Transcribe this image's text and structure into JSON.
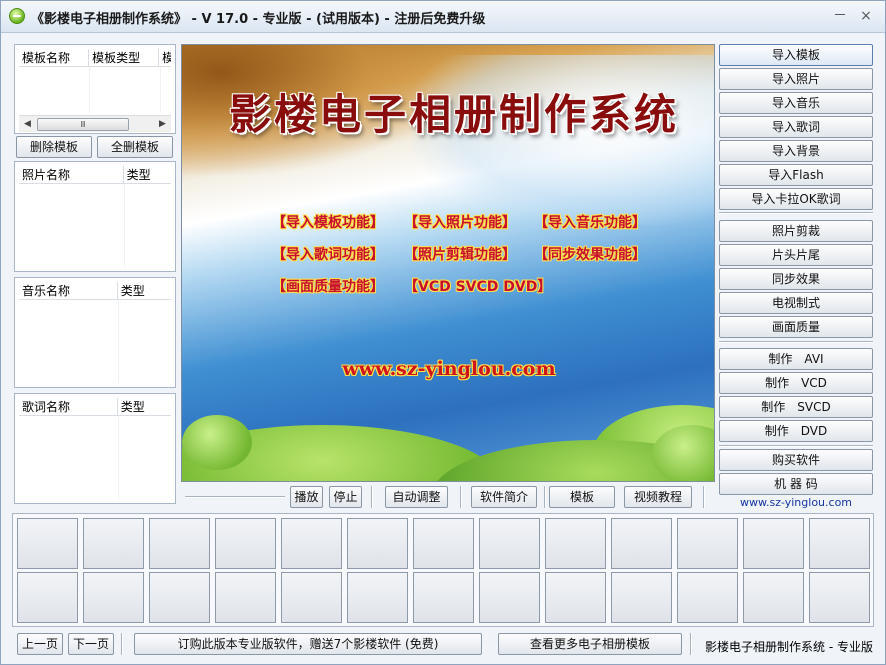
{
  "title": "《影楼电子相册制作系统》 - V 17.0 - 专业版 - (试用版本) - 注册后免费升级",
  "window_controls": {
    "minimize": "－",
    "close": "×"
  },
  "template_list": {
    "columns": [
      "模板名称",
      "模板类型",
      "模"
    ],
    "scroll_thumb": "Ⅲ",
    "delete_button": "删除模板",
    "delete_all_button": "全删模板"
  },
  "photo_list": {
    "columns": [
      "照片名称",
      "类型"
    ]
  },
  "music_list": {
    "columns": [
      "音乐名称",
      "类型"
    ]
  },
  "lyrics_list": {
    "columns": [
      "歌词名称",
      "类型"
    ]
  },
  "preview": {
    "title": "影楼电子相册制作系统",
    "features": [
      "【导入模板功能】",
      "【导入照片功能】",
      "【导入音乐功能】",
      "【导入歌词功能】",
      "【照片剪辑功能】",
      "【同步效果功能】",
      "【画面质量功能】",
      "【VCD SVCD DVD】"
    ],
    "website": "www.sz-yinglou.com"
  },
  "right_buttons": {
    "import_group": [
      "导入模板",
      "导入照片",
      "导入音乐",
      "导入歌词",
      "导入背景",
      "导入Flash",
      "导入卡拉OK歌词"
    ],
    "edit_group": [
      "照片剪裁",
      "片头片尾",
      "同步效果",
      "电视制式",
      "画面质量"
    ],
    "make_group": [
      "制作　AVI",
      "制作　VCD",
      "制作　SVCD",
      "制作　DVD"
    ],
    "buy_group": [
      "购买软件",
      "机 器 码"
    ],
    "website": "www.sz-yinglou.com"
  },
  "controls": {
    "play": "播放",
    "stop": "停止",
    "auto_adjust": "自动调整",
    "intro": "软件简介",
    "template": "模板",
    "video_tutorial": "视频教程"
  },
  "footer": {
    "prev_page": "上一页",
    "next_page": "下一页",
    "promo": "订购此版本专业版软件，赠送7个影楼软件 (免费)",
    "more_templates": "查看更多电子相册模板",
    "status": "影楼电子相册制作系统 - 专业版"
  }
}
